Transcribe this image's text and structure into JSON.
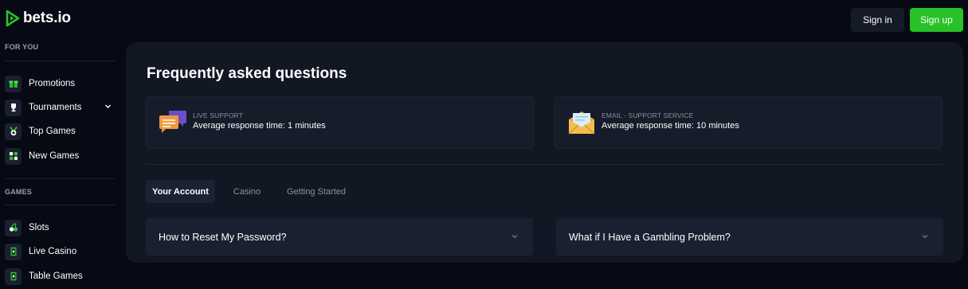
{
  "header": {
    "brand": "bets.io",
    "signin_label": "Sign in",
    "signup_label": "Sign up",
    "accent_color": "#28c228"
  },
  "sidebar": {
    "sections": [
      {
        "title": "FOR YOU",
        "items": [
          {
            "label": "Promotions",
            "icon": "gift-icon"
          },
          {
            "label": "Tournaments",
            "icon": "trophy-icon",
            "expandable": true
          },
          {
            "label": "Top Games",
            "icon": "medal-icon"
          },
          {
            "label": "New Games",
            "icon": "grid-icon"
          }
        ]
      },
      {
        "title": "GAMES",
        "items": [
          {
            "label": "Slots",
            "icon": "cherries-icon"
          },
          {
            "label": "Live Casino",
            "icon": "card-icon"
          },
          {
            "label": "Table Games",
            "icon": "card-icon"
          }
        ]
      }
    ]
  },
  "main": {
    "title": "Frequently asked questions",
    "support": [
      {
        "label": "LIVE SUPPORT",
        "text": "Average response time: 1 minutes",
        "icon": "chat-icon"
      },
      {
        "label": "EMAIL - SUPPORT SERVICE",
        "text": "Average response time: 10 minutes",
        "icon": "mail-icon"
      }
    ],
    "tabs": [
      {
        "label": "Your Account",
        "active": true
      },
      {
        "label": "Casino",
        "active": false
      },
      {
        "label": "Getting Started",
        "active": false
      }
    ],
    "questions": [
      {
        "text": "How to Reset My Password?"
      },
      {
        "text": "What if I Have a Gambling Problem?"
      }
    ]
  }
}
